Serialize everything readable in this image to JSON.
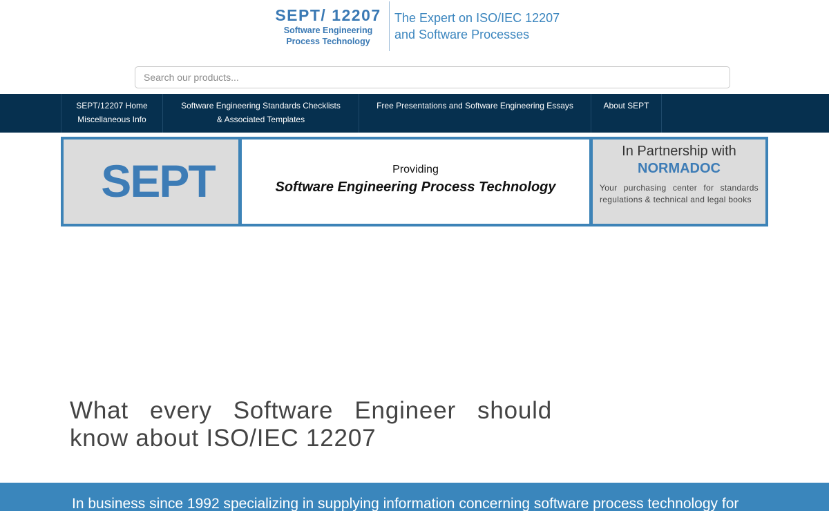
{
  "header": {
    "logo_title": "SEPT/ 12207",
    "logo_sub_line1": "Software Engineering",
    "logo_sub_line2": "Process Technology",
    "tagline_line1": "The Expert on ISO/IEC 12207",
    "tagline_line2": "and Software Processes"
  },
  "search": {
    "placeholder": "Search our products..."
  },
  "nav": {
    "items": [
      {
        "line1": "SEPT/12207 Home",
        "line2": "Miscellaneous Info"
      },
      {
        "line1": "Software Engineering Standards Checklists",
        "line2": "& Associated Templates"
      },
      {
        "line1": "Free Presentations and Software Engineering Essays",
        "line2": ""
      },
      {
        "line1": "About SEPT",
        "line2": ""
      }
    ]
  },
  "banner": {
    "left_logo": "SEPT",
    "providing": "Providing",
    "full_name": "Software Engineering Process Technology",
    "partner_line": "In Partnership with",
    "partner_name": "NORMADOC",
    "partner_desc": "Your purchasing center for standards regulations & technical and legal books"
  },
  "main": {
    "heading": "What every Software Engineer should know about ISO/IEC 12207"
  },
  "footer": {
    "text": "In business since 1992 specializing in supplying information concerning software process technology for"
  },
  "colors": {
    "brand_blue": "#3a79b4",
    "nav_bg": "#06304f",
    "banner_border": "#3d83b7",
    "footer_bg": "#3a86bc"
  }
}
